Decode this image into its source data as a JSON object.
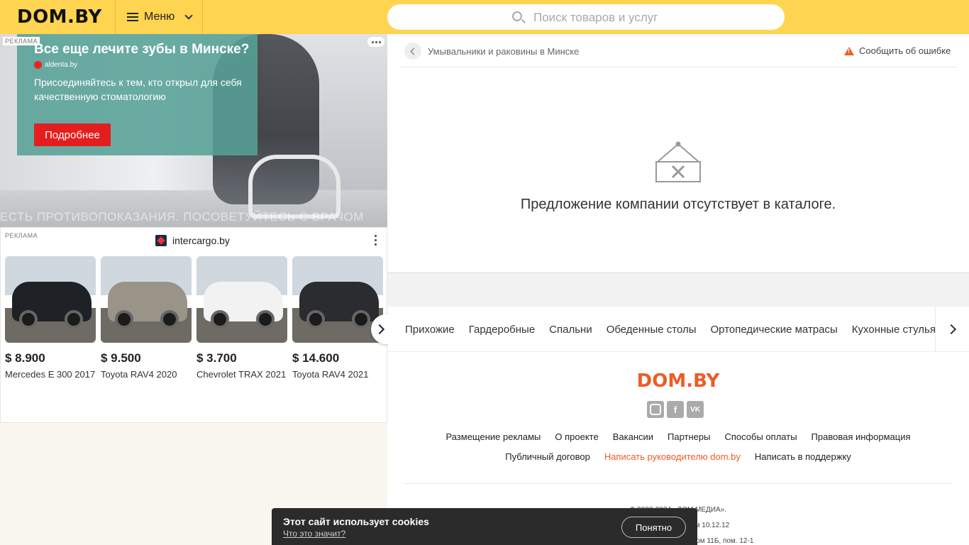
{
  "header": {
    "logo": "DOM.BY",
    "menu_label": "Меню",
    "search_placeholder": "Поиск товаров и услуг"
  },
  "ad_top": {
    "label": "РЕКЛАМА",
    "title": "Все еще лечите зубы в Минске?",
    "site": "aldenta.by",
    "text": "Присоединяйтесь к тем, кто открыл для себя качественную стоматологию",
    "button": "Подробнее",
    "disclaimer": "ЕСТЬ ПРОТИВОПОКАЗАНИЯ. ПОСОВЕТУЙТЕСЬ С ВРАЧОМ"
  },
  "ad_cars": {
    "label": "РЕКЛАМА",
    "site": "intercargo.by",
    "items": [
      {
        "price": "$ 8.900",
        "name": "Mercedes E 300 2017",
        "color": "#1e2226"
      },
      {
        "price": "$ 9.500",
        "name": "Toyota RAV4 2020",
        "color": "#9a9388"
      },
      {
        "price": "$ 3.700",
        "name": "Chevrolet TRAX 2021",
        "color": "#f2f2f2"
      },
      {
        "price": "$ 14.600",
        "name": "Toyota RAV4 2021",
        "color": "#2a2c30"
      }
    ]
  },
  "content": {
    "breadcrumb": "Умывальники и раковины в Минске",
    "report": "Сообщить об ошибке",
    "empty_text": "Предложение компании отсутствует в каталоге."
  },
  "categories": [
    "Прихожие",
    "Гардеробные",
    "Спальни",
    "Обеденные столы",
    "Ортопедические матрасы",
    "Кухонные стулья"
  ],
  "footer": {
    "logo": "DOM.BY",
    "links_row1": [
      "Размещение рекламы",
      "О проекте",
      "Вакансии",
      "Партнеры",
      "Способы оплаты",
      "Правовая информация"
    ],
    "links_row2": [
      "Публичный договор",
      "Написать руководителю dom.by",
      "Написать в поддержку"
    ],
    "legal": [
      "© 2008-2024 «ДОМ МЕДИА».",
      "Минским горисполком 10.12.12",
      "г. Минск, ул. Центральная, дом 11Б, пом. 12-1"
    ],
    "social": {
      "vk": "VK",
      "fb": "f"
    }
  },
  "cookie": {
    "title": "Этот сайт использует cookies",
    "link": "Что это значит?",
    "button": "Понятно"
  },
  "colors": {
    "accent": "#ef5b25",
    "header": "#ffd451"
  }
}
